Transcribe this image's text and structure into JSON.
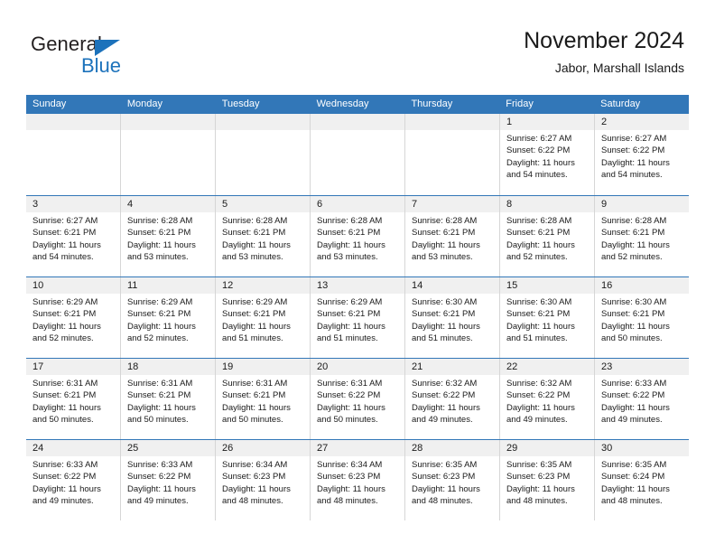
{
  "brand": {
    "name_top": "General",
    "name_bottom": "Blue",
    "accent_color": "#1c72bb"
  },
  "header": {
    "title": "November 2024",
    "subtitle": "Jabor, Marshall Islands"
  },
  "calendar": {
    "header_bg": "#3277b8",
    "weekdays": [
      "Sunday",
      "Monday",
      "Tuesday",
      "Wednesday",
      "Thursday",
      "Friday",
      "Saturday"
    ],
    "weeks": [
      [
        {
          "day": "",
          "sunrise": "",
          "sunset": "",
          "daylight1": "",
          "daylight2": ""
        },
        {
          "day": "",
          "sunrise": "",
          "sunset": "",
          "daylight1": "",
          "daylight2": ""
        },
        {
          "day": "",
          "sunrise": "",
          "sunset": "",
          "daylight1": "",
          "daylight2": ""
        },
        {
          "day": "",
          "sunrise": "",
          "sunset": "",
          "daylight1": "",
          "daylight2": ""
        },
        {
          "day": "",
          "sunrise": "",
          "sunset": "",
          "daylight1": "",
          "daylight2": ""
        },
        {
          "day": "1",
          "sunrise": "Sunrise: 6:27 AM",
          "sunset": "Sunset: 6:22 PM",
          "daylight1": "Daylight: 11 hours",
          "daylight2": "and 54 minutes."
        },
        {
          "day": "2",
          "sunrise": "Sunrise: 6:27 AM",
          "sunset": "Sunset: 6:22 PM",
          "daylight1": "Daylight: 11 hours",
          "daylight2": "and 54 minutes."
        }
      ],
      [
        {
          "day": "3",
          "sunrise": "Sunrise: 6:27 AM",
          "sunset": "Sunset: 6:21 PM",
          "daylight1": "Daylight: 11 hours",
          "daylight2": "and 54 minutes."
        },
        {
          "day": "4",
          "sunrise": "Sunrise: 6:28 AM",
          "sunset": "Sunset: 6:21 PM",
          "daylight1": "Daylight: 11 hours",
          "daylight2": "and 53 minutes."
        },
        {
          "day": "5",
          "sunrise": "Sunrise: 6:28 AM",
          "sunset": "Sunset: 6:21 PM",
          "daylight1": "Daylight: 11 hours",
          "daylight2": "and 53 minutes."
        },
        {
          "day": "6",
          "sunrise": "Sunrise: 6:28 AM",
          "sunset": "Sunset: 6:21 PM",
          "daylight1": "Daylight: 11 hours",
          "daylight2": "and 53 minutes."
        },
        {
          "day": "7",
          "sunrise": "Sunrise: 6:28 AM",
          "sunset": "Sunset: 6:21 PM",
          "daylight1": "Daylight: 11 hours",
          "daylight2": "and 53 minutes."
        },
        {
          "day": "8",
          "sunrise": "Sunrise: 6:28 AM",
          "sunset": "Sunset: 6:21 PM",
          "daylight1": "Daylight: 11 hours",
          "daylight2": "and 52 minutes."
        },
        {
          "day": "9",
          "sunrise": "Sunrise: 6:28 AM",
          "sunset": "Sunset: 6:21 PM",
          "daylight1": "Daylight: 11 hours",
          "daylight2": "and 52 minutes."
        }
      ],
      [
        {
          "day": "10",
          "sunrise": "Sunrise: 6:29 AM",
          "sunset": "Sunset: 6:21 PM",
          "daylight1": "Daylight: 11 hours",
          "daylight2": "and 52 minutes."
        },
        {
          "day": "11",
          "sunrise": "Sunrise: 6:29 AM",
          "sunset": "Sunset: 6:21 PM",
          "daylight1": "Daylight: 11 hours",
          "daylight2": "and 52 minutes."
        },
        {
          "day": "12",
          "sunrise": "Sunrise: 6:29 AM",
          "sunset": "Sunset: 6:21 PM",
          "daylight1": "Daylight: 11 hours",
          "daylight2": "and 51 minutes."
        },
        {
          "day": "13",
          "sunrise": "Sunrise: 6:29 AM",
          "sunset": "Sunset: 6:21 PM",
          "daylight1": "Daylight: 11 hours",
          "daylight2": "and 51 minutes."
        },
        {
          "day": "14",
          "sunrise": "Sunrise: 6:30 AM",
          "sunset": "Sunset: 6:21 PM",
          "daylight1": "Daylight: 11 hours",
          "daylight2": "and 51 minutes."
        },
        {
          "day": "15",
          "sunrise": "Sunrise: 6:30 AM",
          "sunset": "Sunset: 6:21 PM",
          "daylight1": "Daylight: 11 hours",
          "daylight2": "and 51 minutes."
        },
        {
          "day": "16",
          "sunrise": "Sunrise: 6:30 AM",
          "sunset": "Sunset: 6:21 PM",
          "daylight1": "Daylight: 11 hours",
          "daylight2": "and 50 minutes."
        }
      ],
      [
        {
          "day": "17",
          "sunrise": "Sunrise: 6:31 AM",
          "sunset": "Sunset: 6:21 PM",
          "daylight1": "Daylight: 11 hours",
          "daylight2": "and 50 minutes."
        },
        {
          "day": "18",
          "sunrise": "Sunrise: 6:31 AM",
          "sunset": "Sunset: 6:21 PM",
          "daylight1": "Daylight: 11 hours",
          "daylight2": "and 50 minutes."
        },
        {
          "day": "19",
          "sunrise": "Sunrise: 6:31 AM",
          "sunset": "Sunset: 6:21 PM",
          "daylight1": "Daylight: 11 hours",
          "daylight2": "and 50 minutes."
        },
        {
          "day": "20",
          "sunrise": "Sunrise: 6:31 AM",
          "sunset": "Sunset: 6:22 PM",
          "daylight1": "Daylight: 11 hours",
          "daylight2": "and 50 minutes."
        },
        {
          "day": "21",
          "sunrise": "Sunrise: 6:32 AM",
          "sunset": "Sunset: 6:22 PM",
          "daylight1": "Daylight: 11 hours",
          "daylight2": "and 49 minutes."
        },
        {
          "day": "22",
          "sunrise": "Sunrise: 6:32 AM",
          "sunset": "Sunset: 6:22 PM",
          "daylight1": "Daylight: 11 hours",
          "daylight2": "and 49 minutes."
        },
        {
          "day": "23",
          "sunrise": "Sunrise: 6:33 AM",
          "sunset": "Sunset: 6:22 PM",
          "daylight1": "Daylight: 11 hours",
          "daylight2": "and 49 minutes."
        }
      ],
      [
        {
          "day": "24",
          "sunrise": "Sunrise: 6:33 AM",
          "sunset": "Sunset: 6:22 PM",
          "daylight1": "Daylight: 11 hours",
          "daylight2": "and 49 minutes."
        },
        {
          "day": "25",
          "sunrise": "Sunrise: 6:33 AM",
          "sunset": "Sunset: 6:22 PM",
          "daylight1": "Daylight: 11 hours",
          "daylight2": "and 49 minutes."
        },
        {
          "day": "26",
          "sunrise": "Sunrise: 6:34 AM",
          "sunset": "Sunset: 6:23 PM",
          "daylight1": "Daylight: 11 hours",
          "daylight2": "and 48 minutes."
        },
        {
          "day": "27",
          "sunrise": "Sunrise: 6:34 AM",
          "sunset": "Sunset: 6:23 PM",
          "daylight1": "Daylight: 11 hours",
          "daylight2": "and 48 minutes."
        },
        {
          "day": "28",
          "sunrise": "Sunrise: 6:35 AM",
          "sunset": "Sunset: 6:23 PM",
          "daylight1": "Daylight: 11 hours",
          "daylight2": "and 48 minutes."
        },
        {
          "day": "29",
          "sunrise": "Sunrise: 6:35 AM",
          "sunset": "Sunset: 6:23 PM",
          "daylight1": "Daylight: 11 hours",
          "daylight2": "and 48 minutes."
        },
        {
          "day": "30",
          "sunrise": "Sunrise: 6:35 AM",
          "sunset": "Sunset: 6:24 PM",
          "daylight1": "Daylight: 11 hours",
          "daylight2": "and 48 minutes."
        }
      ]
    ]
  }
}
